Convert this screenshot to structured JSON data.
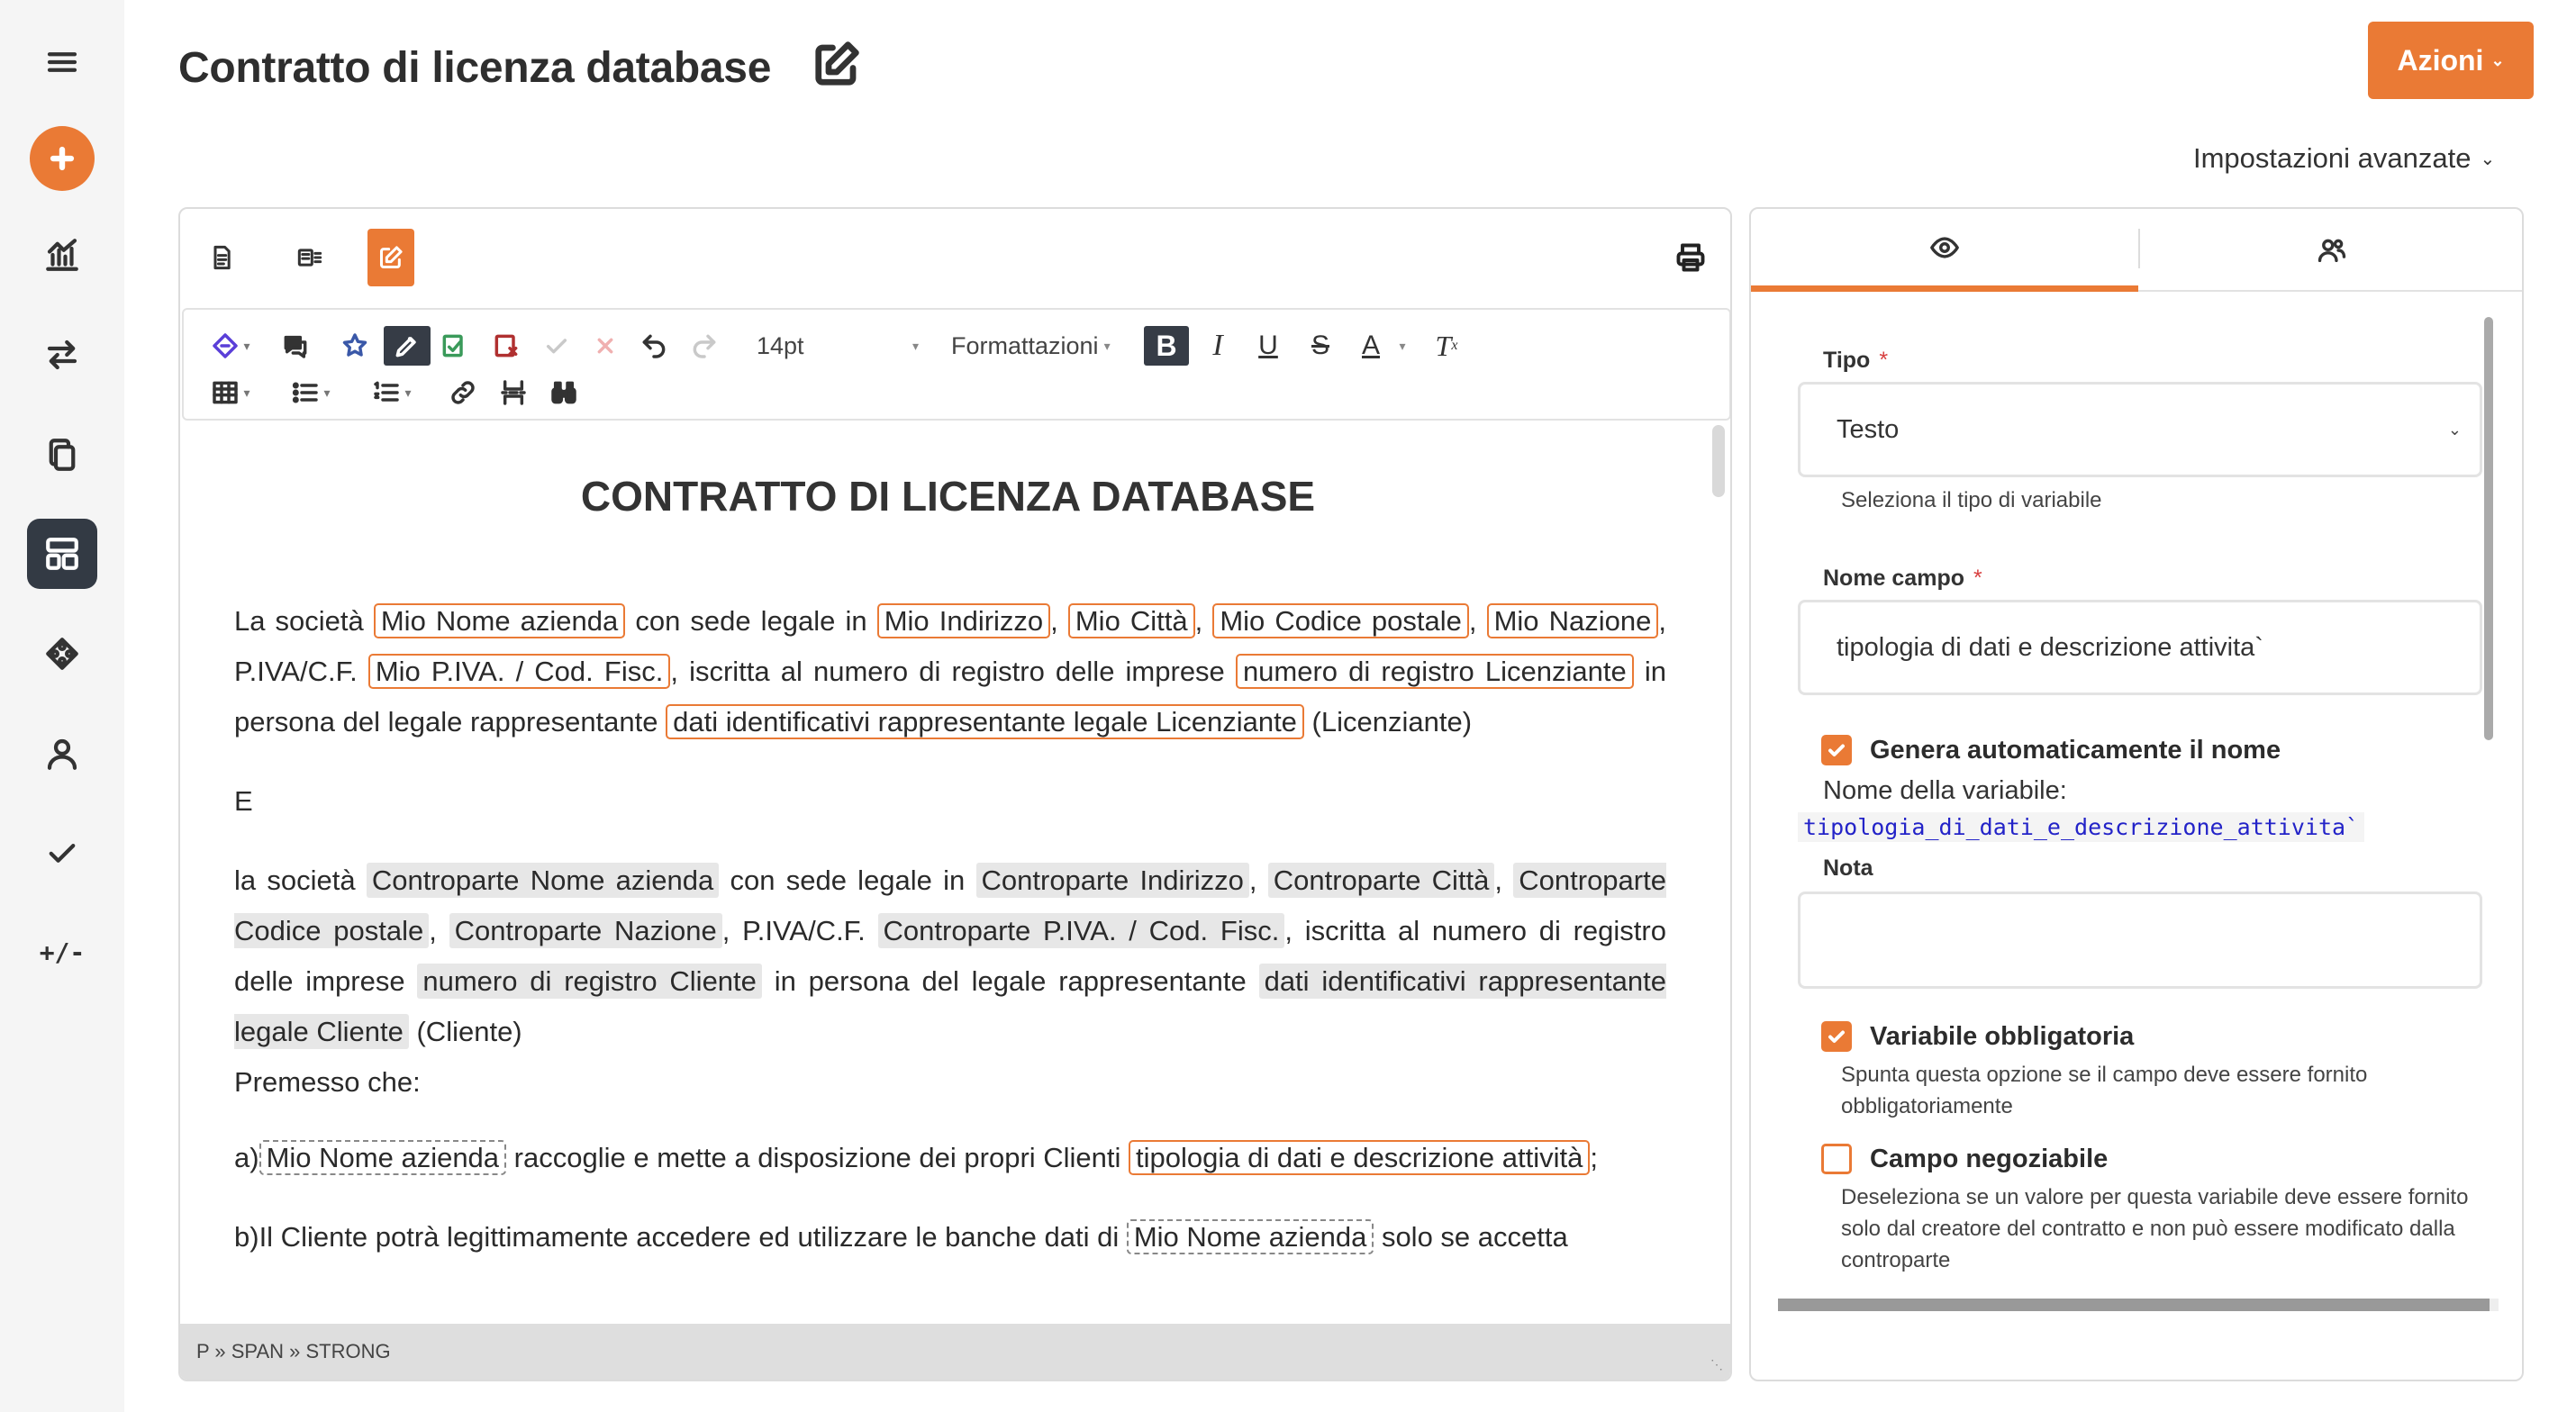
{
  "app": {
    "title": "Contratto di licenza database",
    "actions_label": "Azioni",
    "advanced_label": "Impostazioni avanzate"
  },
  "nav": [
    {
      "icon": "menu-icon"
    },
    {
      "icon": "plus-icon"
    },
    {
      "icon": "chart-icon"
    },
    {
      "icon": "transfer-icon"
    },
    {
      "icon": "documents-icon"
    },
    {
      "icon": "templates-icon",
      "active": true
    },
    {
      "icon": "integrations-icon"
    },
    {
      "icon": "user-icon"
    },
    {
      "icon": "check-icon"
    },
    {
      "icon": "diff-icon",
      "text": "+/-"
    }
  ],
  "editor": {
    "font_size": "14pt",
    "formats_label": "Formattazioni",
    "doc_title": "CONTRATTO DI LICENZA DATABASE",
    "para1": {
      "t1": "La società",
      "v1": "Mio Nome azienda",
      "t2": "con sede legale in",
      "v2": "Mio Indirizzo",
      "v3": "Mio Città",
      "v4": "Mio Codice postale",
      "v5": "Mio Nazione",
      "t3": "P.IVA/C.F.",
      "v6": "Mio P.IVA. / Cod. Fisc.",
      "t4": "iscritta al numero di registro delle imprese",
      "v7": "numero di registro Licenziante",
      "t5": "in persona del legale rappresentante",
      "v8": "dati identificativi rappresentante legale Licenziante",
      "t6": "(Licenziante)"
    },
    "conj": "E",
    "para2": {
      "t1": "la società",
      "v1": "Controparte Nome azienda",
      "t2": "con sede legale in",
      "v2": "Controparte Indirizzo",
      "v3": "Controparte Città",
      "v4": "Controparte Codice postale",
      "v5": "Controparte Nazione",
      "t3": "P.IVA/C.F.",
      "v6": "Controparte P.IVA. / Cod. Fisc.",
      "t4": "iscritta al numero di registro delle imprese",
      "v7": "numero di registro Cliente",
      "t5": "in persona del legale rappresentante",
      "v8": "dati identificativi rappresentante legale Cliente",
      "t6": "(Cliente)"
    },
    "premise": "Premesso che:",
    "item_a": {
      "prefix": "a)",
      "v1": "Mio Nome azienda",
      "t1": "raccoglie e mette a disposizione dei propri Clienti",
      "v2": "tipologia di dati e descrizione attività",
      "t2": ";"
    },
    "item_b": {
      "prefix": "b)Il Cliente potrà legittimamente accedere ed utilizzare le banche dati di",
      "v1": "Mio Nome azienda",
      "t1": "solo se accetta"
    },
    "status_path": "P » SPAN » STRONG"
  },
  "panel": {
    "tipo_label": "Tipo",
    "tipo_value": "Testo",
    "tipo_hint": "Seleziona il tipo di variabile",
    "nome_label": "Nome campo",
    "nome_value": "tipologia di dati e descrizione attivita`",
    "auto_name_label": "Genera automaticamente il nome",
    "auto_name_checked": true,
    "var_name_label": "Nome della variabile:",
    "var_name_value": "tipologia_di_dati_e_descrizione_attivita`",
    "nota_label": "Nota",
    "nota_value": "",
    "mandatory_label": "Variabile obbligatoria",
    "mandatory_checked": true,
    "mandatory_hint": "Spunta questa opzione se il campo deve essere fornito obbligatoriamente",
    "negotiable_label": "Campo negoziabile",
    "negotiable_checked": false,
    "negotiable_hint": "Deseleziona se un valore per questa variabile deve essere fornito solo dal creatore del contratto e non può essere modificato dalla controparte"
  },
  "colors": {
    "accent": "#ea7a35",
    "rail_bg": "#f5f5f5",
    "active_nav": "#333a44",
    "variable_code": "#2323c8",
    "required": "#d84040"
  }
}
